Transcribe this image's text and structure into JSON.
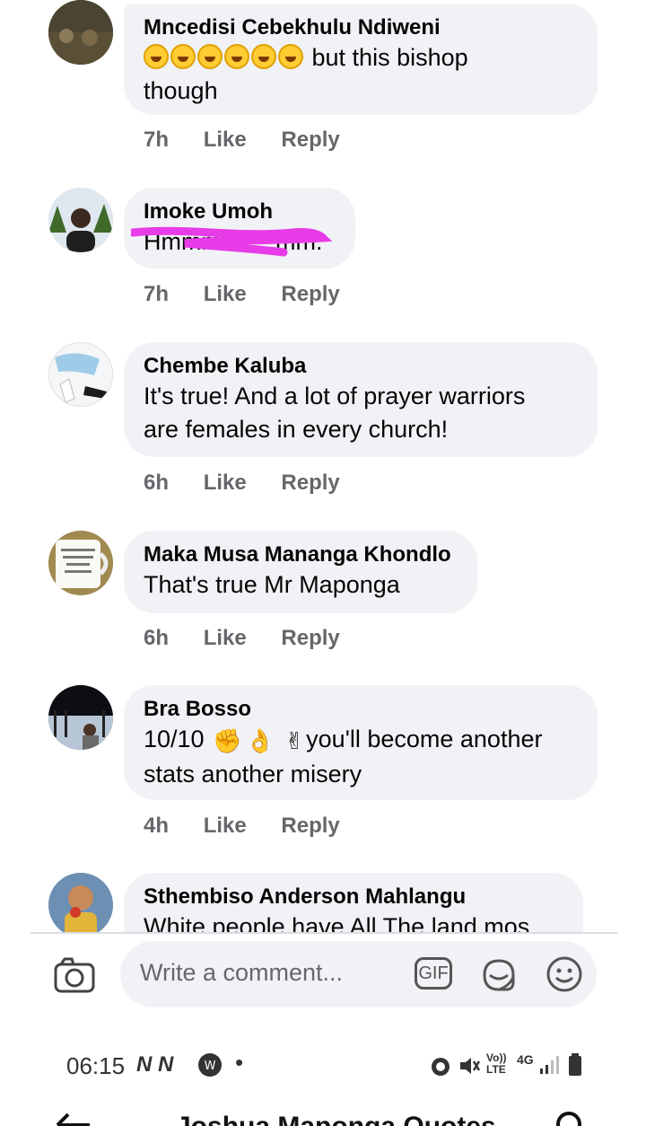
{
  "comments": [
    {
      "author": "Mncedisi Cebekhulu Ndiweni",
      "text_prefix_emoji_count": 6,
      "text_line1": "but this bishop",
      "text_line2": "though",
      "time": "7h",
      "like": "Like",
      "reply": "Reply"
    },
    {
      "author": "Imoke Umoh",
      "text": "Hmmm........mm.",
      "time": "7h",
      "like": "Like",
      "reply": "Reply"
    },
    {
      "author": "Chembe Kaluba",
      "text_line1": "It's true! And a lot of prayer warriors",
      "text_line2": "are females in every church!",
      "time": "6h",
      "like": "Like",
      "reply": "Reply"
    },
    {
      "author": "Maka Musa Mananga Khondlo",
      "text": "That's true Mr Maponga",
      "time": "6h",
      "like": "Like",
      "reply": "Reply"
    },
    {
      "author": "Bra Bosso",
      "text_line1_prefix": "10/10",
      "text_line1_suffix": "you'll become another",
      "text_line2": "stats another misery",
      "time": "4h",
      "like": "Like",
      "reply": "Reply"
    },
    {
      "author": "Sthembiso Anderson Mahlangu",
      "text": "White people have All The land mos"
    }
  ],
  "composer": {
    "placeholder": "Write a comment...",
    "gif_label": "GIF"
  },
  "status_bar": {
    "time": "06:15",
    "network_label": "4G",
    "volte_label": "Vo)) LTE"
  },
  "navigation": {
    "title": "Joshua Maponga Quotes"
  },
  "colors": {
    "bubble": "#f0f2f5",
    "meta_text": "#65676b",
    "scribble": "#e83ce8"
  },
  "icons": [
    "camera-icon",
    "gif-icon",
    "sticker-icon",
    "emoji-icon",
    "back-arrow-icon",
    "search-icon",
    "alarm-icon",
    "mute-icon",
    "signal-icon",
    "battery-icon"
  ]
}
